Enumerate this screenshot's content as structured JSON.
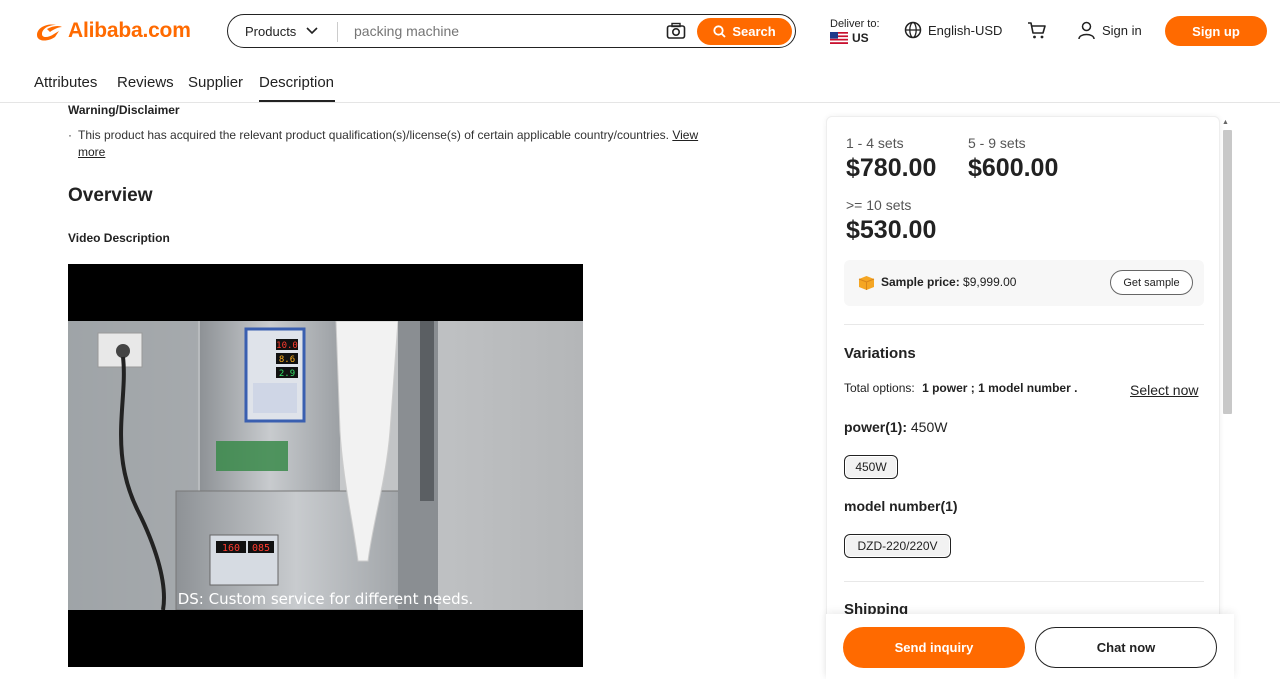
{
  "header": {
    "logo_text": "Alibaba.com",
    "search": {
      "category": "Products",
      "placeholder": "packing machine",
      "button_label": "Search"
    },
    "deliver": {
      "label": "Deliver to:",
      "country": "US"
    },
    "language": "English-USD",
    "sign_in": "Sign in",
    "sign_up": "Sign up"
  },
  "tabs": [
    {
      "label": "Attributes"
    },
    {
      "label": "Reviews"
    },
    {
      "label": "Supplier"
    },
    {
      "label": "Description",
      "active": true
    }
  ],
  "main": {
    "warning_title": "Warning/Disclaimer",
    "warning_bullet": "·",
    "warning_text": "This product has acquired the relevant product qualification(s)/license(s) of certain applicable country/countries.",
    "warning_link_1": "View",
    "warning_link_2": "more",
    "overview_title": "Overview",
    "video_title": "Video Description",
    "video_caption": "DS: Custom service for different needs.",
    "video_panel_top": "10.0",
    "video_panel_mid": "8.6",
    "video_panel_low": "2.9",
    "video_display_a": "160",
    "video_display_b": "085"
  },
  "pricing": {
    "tiers": [
      {
        "qty": "1 - 4 sets",
        "price": "$780.00"
      },
      {
        "qty": "5 - 9 sets",
        "price": "$600.00"
      },
      {
        "qty": ">= 10 sets",
        "price": "$530.00"
      }
    ],
    "sample_label": "Sample price:",
    "sample_value": "$9,999.00",
    "get_sample": "Get sample"
  },
  "variations": {
    "title": "Variations",
    "total_label": "Total options:",
    "total_value": "1 power ; 1 model number .",
    "select_now": "Select now",
    "power_label": "power(1):",
    "power_value": "450W",
    "power_chip": "450W",
    "model_label": "model number(1)",
    "model_chip": "DZD-220/220V"
  },
  "shipping_title": "Shipping",
  "actions": {
    "send_inquiry": "Send inquiry",
    "chat_now": "Chat now"
  },
  "colors": {
    "brand": "#ff6a00",
    "text": "#222222"
  }
}
